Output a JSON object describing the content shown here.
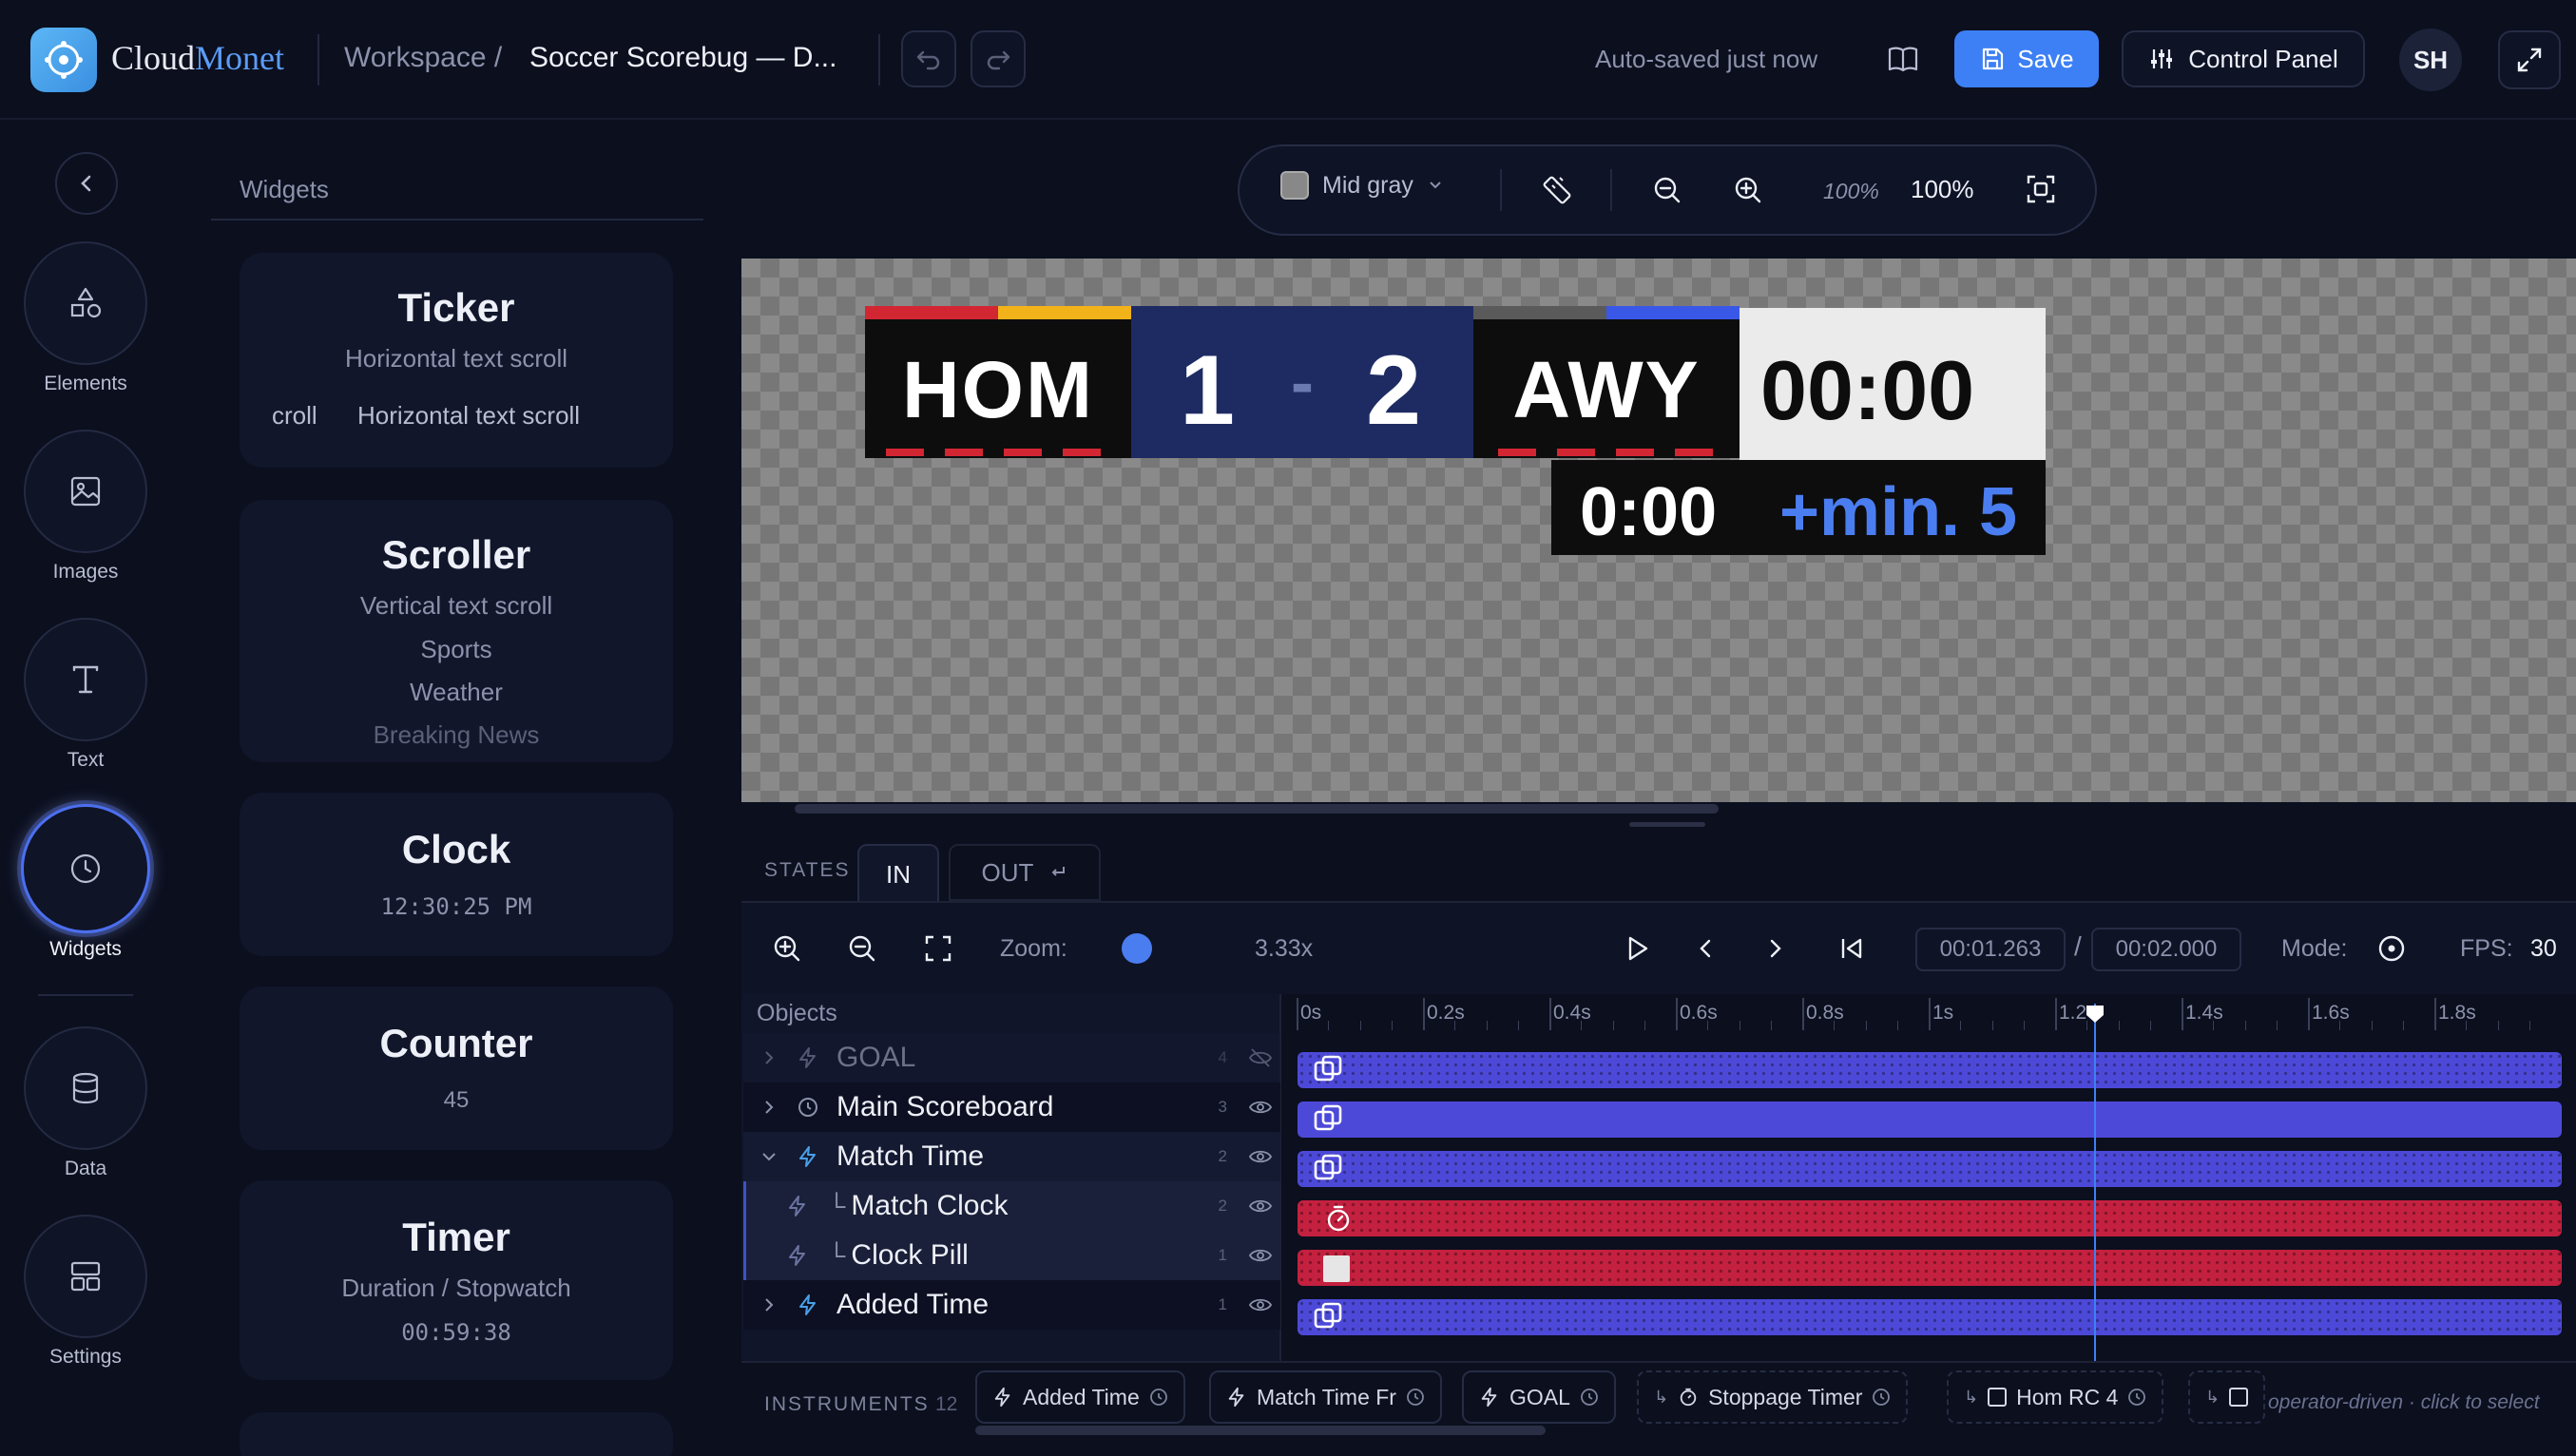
{
  "app": {
    "brand_first": "Cloud",
    "brand_second": "Monet"
  },
  "header": {
    "breadcrumb_root": "Workspace /",
    "document_title": "Soccer Scorebug — D...",
    "autosave_status": "Auto-saved just now",
    "save_label": "Save",
    "control_panel_label": "Control Panel",
    "avatar_initials": "SH"
  },
  "rail": {
    "items": [
      {
        "label": "Elements",
        "icon": "shapes-icon"
      },
      {
        "label": "Images",
        "icon": "image-icon"
      },
      {
        "label": "Text",
        "icon": "text-icon"
      },
      {
        "label": "Widgets",
        "icon": "clock-icon"
      },
      {
        "label": "Data",
        "icon": "database-icon"
      },
      {
        "label": "Settings",
        "icon": "layout-icon"
      }
    ],
    "active": "Widgets"
  },
  "widgets_panel": {
    "heading": "Widgets",
    "cards": [
      {
        "title": "Ticker",
        "subtitle": "Horizontal text scroll",
        "preview_a": "croll",
        "preview_b": "Horizontal text scroll"
      },
      {
        "title": "Scroller",
        "subtitle": "Vertical text scroll",
        "lines": [
          "Sports",
          "Weather",
          "Breaking News"
        ]
      },
      {
        "title": "Clock",
        "value": "12:30:25 PM"
      },
      {
        "title": "Counter",
        "value": "45"
      },
      {
        "title": "Timer",
        "subtitle": "Duration / Stopwatch",
        "value": "00:59:38"
      }
    ]
  },
  "canvas_toolbar": {
    "background_option": "Mid gray",
    "zoom_small": "100%",
    "zoom_value": "100%"
  },
  "scorebug": {
    "home_team": "HOM",
    "home_score": "1",
    "score_separator": "-",
    "away_score": "2",
    "away_team": "AWY",
    "clock": "00:00",
    "added_clock": "0:00",
    "added_time": "+min. 5",
    "colors": {
      "home_primary": "#d22633",
      "home_secondary": "#f2b21a",
      "away_primary": "#3a58e8",
      "score_bg": "#1e2b63",
      "added_time": "#4a7df0"
    }
  },
  "states": {
    "label": "STATES",
    "tabs": [
      "IN",
      "OUT"
    ],
    "active": "IN"
  },
  "transport": {
    "zoom_label": "Zoom:",
    "zoom_value": "3.33x",
    "current_time": "00:01.263",
    "time_separator": "/",
    "total_time": "00:02.000",
    "mode_label": "Mode:",
    "fps_label": "FPS:",
    "fps_value": "30",
    "playhead_seconds": 1.263,
    "duration_seconds": 2.0
  },
  "timeline": {
    "objects_header": "Objects",
    "ruler_ticks": [
      "0s",
      "0.2s",
      "0.4s",
      "0.6s",
      "0.8s",
      "1s",
      "1.2",
      "1.4s",
      "1.6s",
      "1.8s"
    ],
    "layers": [
      {
        "name": "GOAL",
        "count": "4",
        "hidden": true,
        "bar_color": "blue"
      },
      {
        "name": "Main Scoreboard",
        "count": "3",
        "hidden": false,
        "bar_color": "blue"
      },
      {
        "name": "Match Time",
        "count": "2",
        "hidden": false,
        "bar_color": "blue"
      },
      {
        "name": "Match Clock",
        "count": "2",
        "hidden": false,
        "bar_color": "red"
      },
      {
        "name": "Clock Pill",
        "count": "1",
        "hidden": false,
        "bar_color": "red"
      },
      {
        "name": "Added Time",
        "count": "1",
        "hidden": false,
        "bar_color": "blue"
      }
    ]
  },
  "instruments": {
    "label": "INSTRUMENTS",
    "count": "12",
    "chips": [
      "Added Time",
      "Match Time Fr",
      "GOAL",
      "Stoppage Timer",
      "Hom RC 4"
    ],
    "hint": "operator-driven · click to select"
  }
}
